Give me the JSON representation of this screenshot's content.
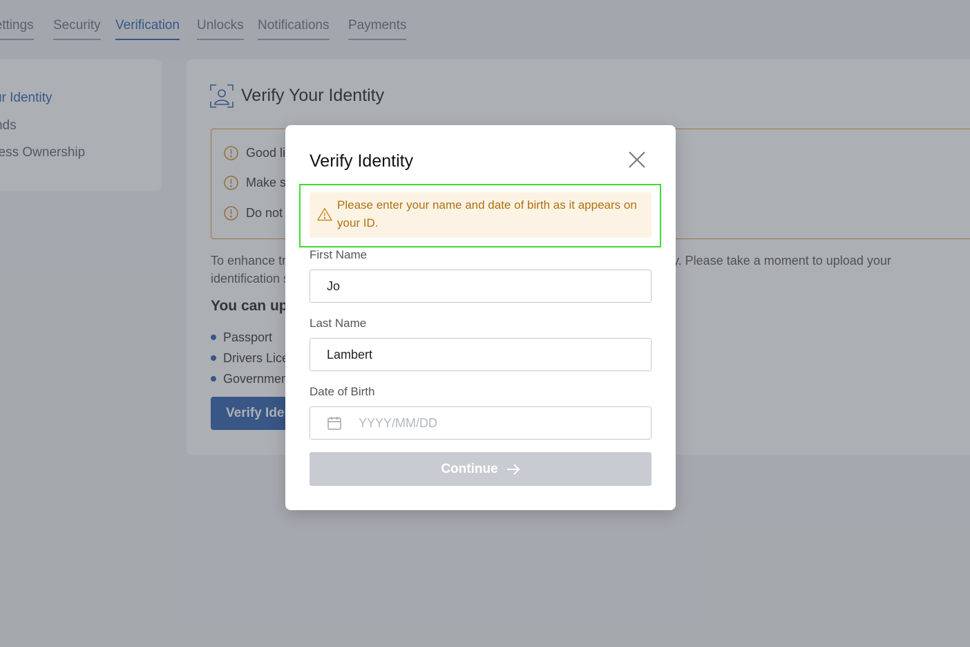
{
  "tabs": [
    {
      "label": "Settings"
    },
    {
      "label": "Security"
    },
    {
      "label": "Verification"
    },
    {
      "label": "Unlocks"
    },
    {
      "label": "Notifications"
    },
    {
      "label": "Payments"
    }
  ],
  "sidebar": {
    "items": [
      {
        "label": "Verify Your Identity"
      },
      {
        "label": "Verify Funds"
      },
      {
        "label": "Business Ownership"
      }
    ]
  },
  "main": {
    "title": "Verify Your Identity",
    "tips": [
      "Good lig",
      "Make su",
      "Do not"
    ],
    "intro_left_line1": "To enhance tru",
    "intro_left_line2": "identification s",
    "intro_right": "ity. Please take a moment to upload your",
    "upload_heading": "You can uplo",
    "documents": [
      "Passport",
      "Drivers Lice",
      "Governmen"
    ],
    "verify_button": "Verify Iden"
  },
  "modal": {
    "title": "Verify Identity",
    "alert": "Please enter your name and date of birth as it appears on your ID.",
    "first_name_label": "First Name",
    "first_name_value": "Jo",
    "last_name_label": "Last Name",
    "last_name_value": "Lambert",
    "dob_label": "Date of Birth",
    "dob_placeholder": "YYYY/MM/DD",
    "continue_label": "Continue"
  },
  "colors": {
    "accent": "#2d5eab",
    "warning_text": "#b07010",
    "warning_bg": "#fdf3e4",
    "highlight": "#3ddc2f",
    "disabled_button": "#c8ccd2"
  }
}
